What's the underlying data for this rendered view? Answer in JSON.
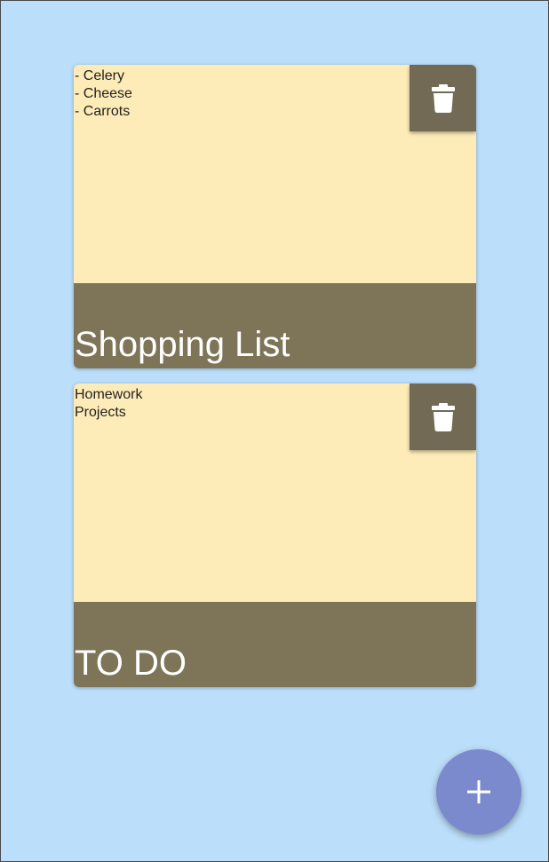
{
  "notes": [
    {
      "title": "Shopping List",
      "lines": [
        "- Celery",
        "- Cheese",
        "- Carrots"
      ],
      "delete_icon": "trash-icon"
    },
    {
      "title": "TO DO",
      "lines": [
        "Homework",
        "Projects"
      ],
      "delete_icon": "trash-icon"
    }
  ],
  "fab": {
    "icon": "plus-icon"
  },
  "colors": {
    "background": "#bbdefa",
    "note_body": "#feecb8",
    "note_footer": "#7e7558",
    "delete_button": "#726a54",
    "fab": "#7b8acd"
  }
}
